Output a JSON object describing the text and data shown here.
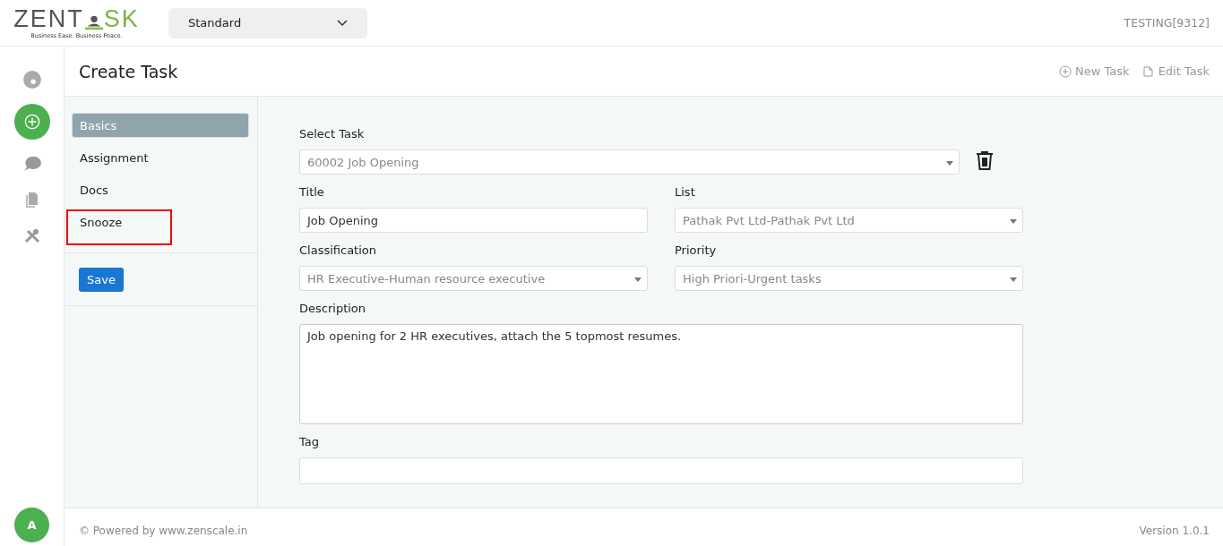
{
  "logo": {
    "left": "ZENT",
    "right": "SK",
    "tagline": "Business Ease. Business Peace."
  },
  "mode_select": {
    "value": "Standard"
  },
  "account": "TESTING[9312]",
  "rail": [
    {
      "kind": "dashboard",
      "selected": false
    },
    {
      "kind": "add",
      "selected": true
    },
    {
      "kind": "chat",
      "selected": false
    },
    {
      "kind": "docs",
      "selected": false
    },
    {
      "kind": "tools",
      "selected": false
    }
  ],
  "avatar": "A",
  "page": {
    "title": "Create Task",
    "actions": [
      {
        "kind": "new",
        "label": "New Task"
      },
      {
        "kind": "edit",
        "label": "Edit Task"
      }
    ]
  },
  "sections": [
    {
      "label": "Basics",
      "selected": true,
      "highlighted": false
    },
    {
      "label": "Assignment",
      "selected": false,
      "highlighted": false
    },
    {
      "label": "Docs",
      "selected": false,
      "highlighted": false
    },
    {
      "label": "Snooze",
      "selected": false,
      "highlighted": true
    }
  ],
  "save_button": "Save",
  "form": {
    "select_task": {
      "label": "Select Task",
      "value": "60002 Job Opening"
    },
    "title": {
      "label": "Title",
      "value": "Job Opening"
    },
    "list": {
      "label": "List",
      "value": "Pathak Pvt Ltd-Pathak Pvt Ltd"
    },
    "classification": {
      "label": "Classification",
      "value": "HR Executive-Human resource executive"
    },
    "priority": {
      "label": "Priority",
      "value": "High Priori-Urgent tasks"
    },
    "description": {
      "label": "Description",
      "value": "Job opening for 2 HR executives, attach the 5 topmost resumes."
    },
    "tag": {
      "label": "Tag"
    }
  },
  "footer": {
    "powered": "© Powered by www.zenscale.in",
    "version": "Version 1.0.1"
  }
}
